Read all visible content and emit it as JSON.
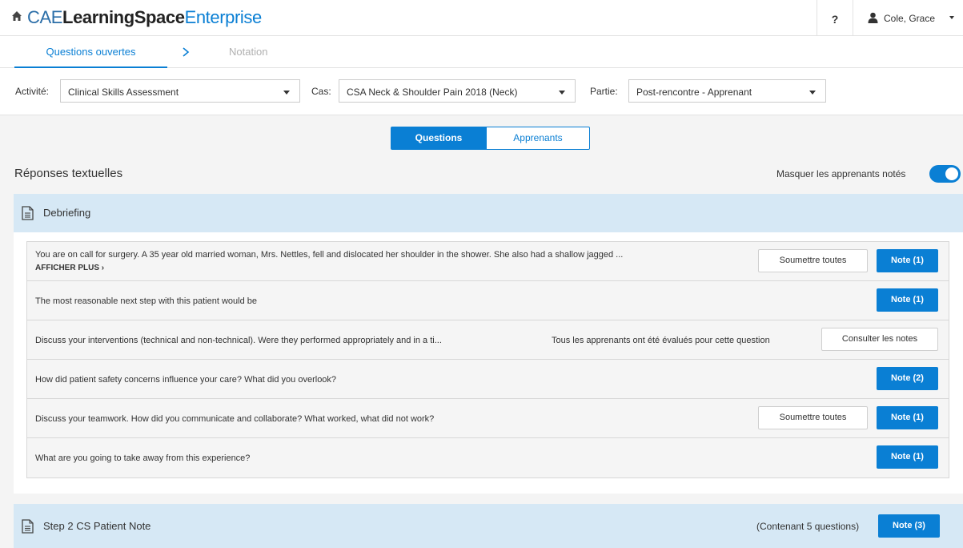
{
  "brand": {
    "part1": "CAE",
    "part2": "LearningSpace",
    "part3": "Enterprise"
  },
  "header": {
    "help": "?",
    "user_name": "Cole, Grace"
  },
  "steps": {
    "active": "Questions ouvertes",
    "next": "Notation"
  },
  "filters": {
    "activity_label": "Activité:",
    "activity_value": "Clinical Skills Assessment",
    "case_label": "Cas:",
    "case_value": "CSA Neck & Shoulder Pain 2018 (Neck)",
    "part_label": "Partie:",
    "part_value": "Post-rencontre - Apprenant"
  },
  "view_toggle": {
    "questions": "Questions",
    "learners": "Apprenants"
  },
  "section": {
    "title": "Réponses textuelles",
    "hide_graded_label": "Masquer les apprenants notés",
    "hide_graded_on": true
  },
  "groups": [
    {
      "name": "Debriefing",
      "questions": [
        {
          "text": "You are on call for surgery. A 35 year old married woman, Mrs. Nettles, fell and dislocated her shoulder in the shower. She also had a shallow jagged ...",
          "more": "AFFICHER PLUS ›",
          "submit_all": "Soumettre toutes",
          "note": "Note (1)"
        },
        {
          "text": "The most reasonable next step with this patient would be",
          "note": "Note (1)"
        },
        {
          "text": "Discuss your interventions (technical and non-technical). Were they performed appropriately and in a ti...",
          "info": "Tous les apprenants ont été évalués pour cette question",
          "view_notes": "Consulter les notes"
        },
        {
          "text": "How did patient safety concerns influence your care? What did you overlook?",
          "note": "Note (2)"
        },
        {
          "text": "Discuss your teamwork. How did you communicate and collaborate? What worked, what did not work?",
          "submit_all": "Soumettre toutes",
          "note": "Note (1)"
        },
        {
          "text": "What are you going to take away from this experience?",
          "note": "Note (1)"
        }
      ]
    },
    {
      "name": "Step 2 CS Patient Note",
      "count": "(Contenant 5 questions)",
      "note": "Note (3)"
    }
  ]
}
